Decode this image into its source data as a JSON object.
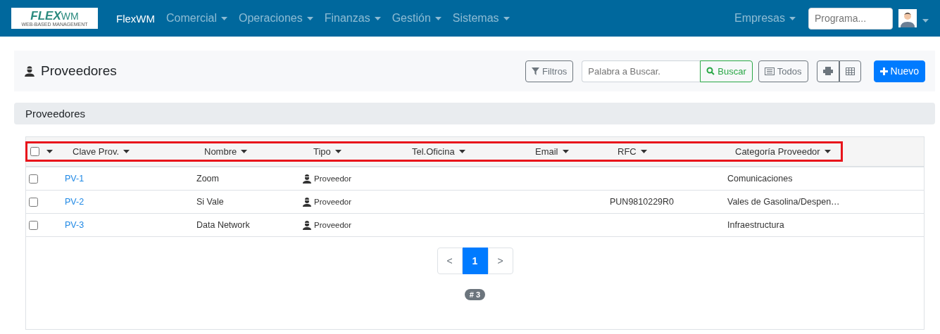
{
  "navbar": {
    "logo": {
      "main": "FLEX",
      "accent": "WM",
      "tagline": "WEB-BASED MANAGEMENT"
    },
    "brand": "FlexWM",
    "menus": [
      {
        "label": "Comercial"
      },
      {
        "label": "Operaciones"
      },
      {
        "label": "Finanzas"
      },
      {
        "label": "Gestión"
      },
      {
        "label": "Sistemas"
      }
    ],
    "right_menu": "Empresas",
    "program_search": {
      "placeholder": "Programa..."
    }
  },
  "page_header": {
    "title": "Proveedores",
    "filters_button": "Filtros",
    "search": {
      "placeholder": "Palabra a Buscar."
    },
    "search_button": "Buscar",
    "all_button": "Todos",
    "new_button": "Nuevo"
  },
  "section": {
    "title": "Proveedores"
  },
  "table": {
    "header_highlighted": true,
    "select_all_checked": false,
    "columns": [
      "Clave Prov.",
      "Nombre",
      "Tipo",
      "Tel.Oficina",
      "Email",
      "RFC",
      "Categoría Proveedor"
    ],
    "rows": [
      {
        "checked": false,
        "clave": "PV-1",
        "nombre": "Zoom",
        "tipo": "Proveedor",
        "tel": "",
        "email": "",
        "rfc": "",
        "categoria": "Comunicaciones"
      },
      {
        "checked": false,
        "clave": "PV-2",
        "nombre": "Si Vale",
        "tipo": "Proveedor",
        "tel": "",
        "email": "",
        "rfc": "PUN9810229R0",
        "categoria": "Vales de Gasolina/Despen…"
      },
      {
        "checked": false,
        "clave": "PV-3",
        "nombre": "Data Network",
        "tipo": "Proveedor",
        "tel": "",
        "email": "",
        "rfc": "",
        "categoria": "Infraestructura"
      }
    ]
  },
  "pagination": {
    "prev": "<",
    "pages": [
      {
        "label": "1",
        "selected": true
      }
    ],
    "next": ">"
  },
  "count_badge": "# 3"
}
